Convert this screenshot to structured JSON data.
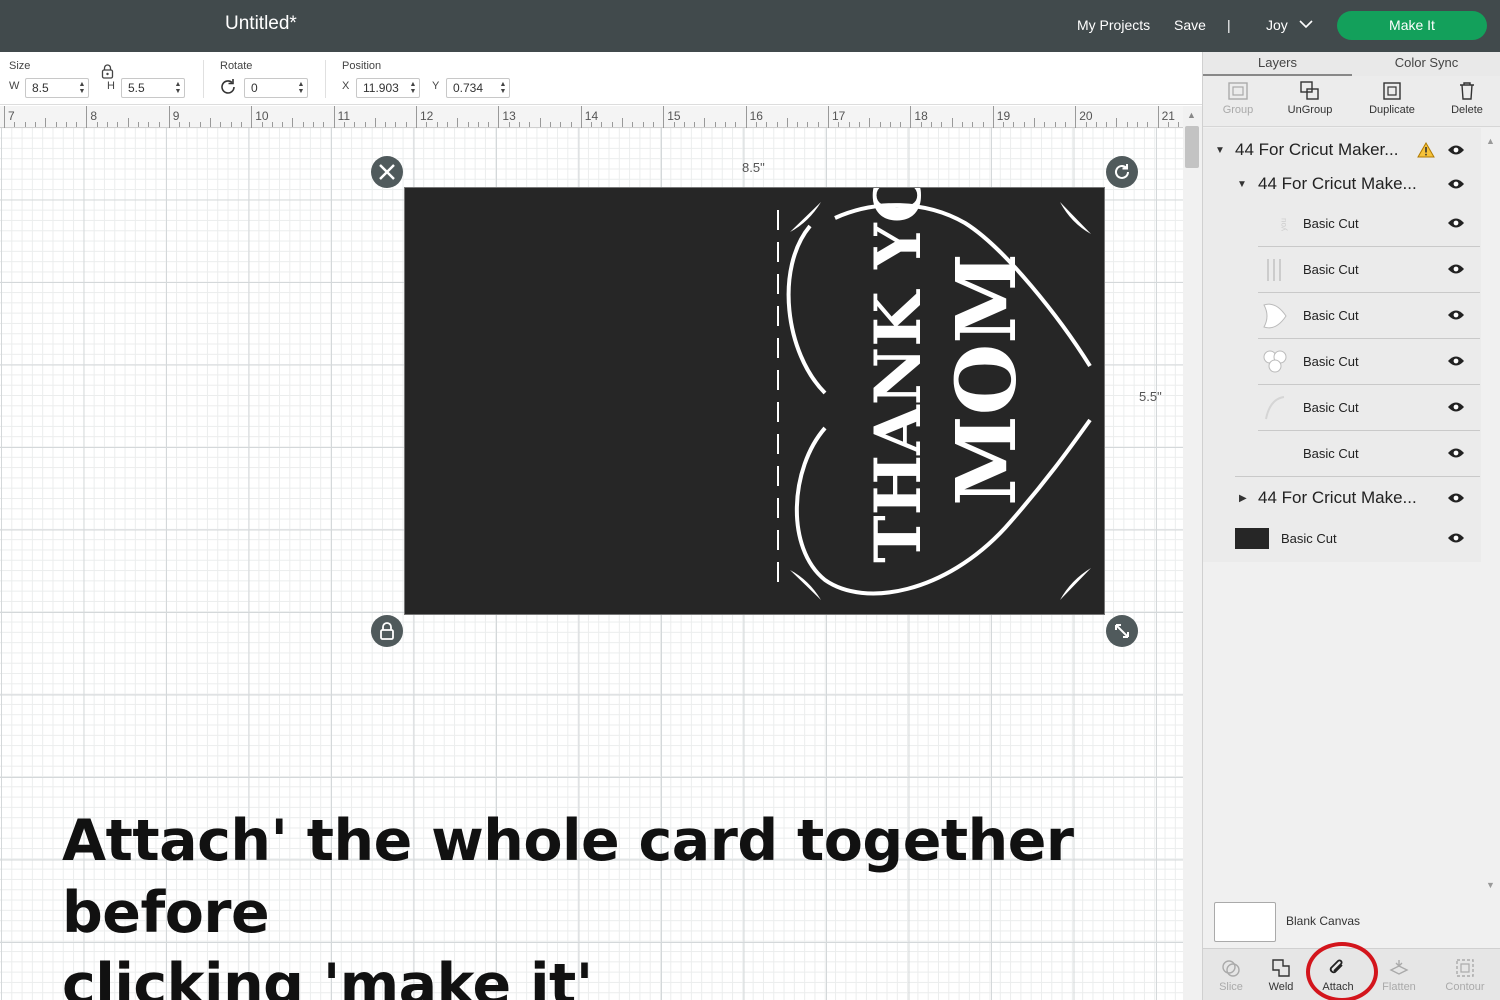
{
  "header": {
    "title": "Untitled*",
    "my_projects": "My Projects",
    "save": "Save",
    "divider": "|",
    "user": "Joy",
    "make_it": "Make It",
    "make_it_color": "#13a05b"
  },
  "toolbar": {
    "size_label": "Size",
    "w_label": "W",
    "w_value": "8.5",
    "h_label": "H",
    "h_value": "5.5",
    "rotate_label": "Rotate",
    "rotate_value": "0",
    "position_label": "Position",
    "x_label": "X",
    "x_value": "11.903",
    "y_label": "Y",
    "y_value": "0.734"
  },
  "ruler": {
    "numbers": [
      "7",
      "8",
      "9",
      "10",
      "11",
      "12",
      "13",
      "14",
      "15",
      "16",
      "17",
      "18",
      "19",
      "20",
      "21"
    ]
  },
  "canvas": {
    "width_dim": "8.5\"",
    "height_dim": "5.5\"",
    "card_color": "#262626",
    "card_text_1": "THANK YOU",
    "card_text_2": "MOM"
  },
  "instruction": {
    "strong": "Attach",
    "rest_1": "' the whole card together before",
    "rest_2": "clicking 'make it'"
  },
  "panel": {
    "tabs": [
      "Layers",
      "Color Sync"
    ],
    "tools": [
      "Group",
      "UnGroup",
      "Duplicate",
      "Delete"
    ],
    "layers": {
      "group_top": "44 For Cricut Maker...",
      "group_sub": "44 For Cricut Make...",
      "items": [
        "Basic Cut",
        "Basic Cut",
        "Basic Cut",
        "Basic Cut",
        "Basic Cut",
        "Basic Cut"
      ],
      "group_collapsed": "44 For Cricut Make...",
      "base_layer": "Basic Cut"
    },
    "blank_canvas": "Blank Canvas",
    "bottom_tools": [
      "Slice",
      "Weld",
      "Attach",
      "Flatten",
      "Contour"
    ],
    "highlight_color": "#d3151c"
  }
}
